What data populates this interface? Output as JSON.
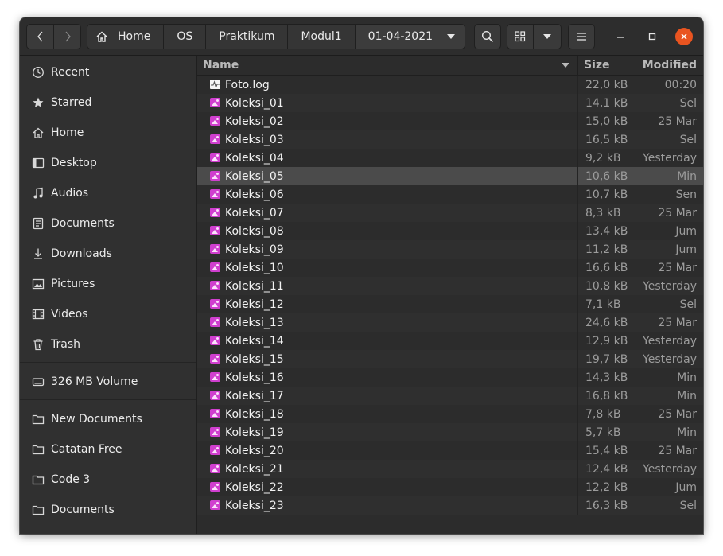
{
  "window": {
    "nav": {
      "back": "back",
      "forward": "forward"
    },
    "pathbar": [
      "Home",
      "OS",
      "Praktikum",
      "Modul1",
      "01-04-2021"
    ]
  },
  "sidebar": {
    "places": [
      {
        "label": "Recent",
        "icon": "clock-icon"
      },
      {
        "label": "Starred",
        "icon": "star-icon"
      },
      {
        "label": "Home",
        "icon": "home-icon"
      },
      {
        "label": "Desktop",
        "icon": "desktop-icon"
      },
      {
        "label": "Audios",
        "icon": "music-icon"
      },
      {
        "label": "Documents",
        "icon": "document-icon"
      },
      {
        "label": "Downloads",
        "icon": "download-icon"
      },
      {
        "label": "Pictures",
        "icon": "picture-icon"
      },
      {
        "label": "Videos",
        "icon": "film-icon"
      },
      {
        "label": "Trash",
        "icon": "trash-icon"
      }
    ],
    "devices": [
      {
        "label": "326 MB Volume",
        "icon": "drive-icon"
      }
    ],
    "bookmarks": [
      {
        "label": "New Documents",
        "icon": "folder-icon"
      },
      {
        "label": "Catatan Free",
        "icon": "folder-icon"
      },
      {
        "label": "Code 3",
        "icon": "folder-icon"
      },
      {
        "label": "Documents",
        "icon": "folder-icon"
      }
    ]
  },
  "columns": {
    "name": "Name",
    "size": "Size",
    "modified": "Modified"
  },
  "files": [
    {
      "name": "Foto.log",
      "size": "22,0 kB",
      "modified": "00:20",
      "type": "log"
    },
    {
      "name": "Koleksi_01",
      "size": "14,1 kB",
      "modified": "Sel",
      "type": "image"
    },
    {
      "name": "Koleksi_02",
      "size": "15,0 kB",
      "modified": "25 Mar",
      "type": "image"
    },
    {
      "name": "Koleksi_03",
      "size": "16,5 kB",
      "modified": "Sel",
      "type": "image"
    },
    {
      "name": "Koleksi_04",
      "size": "9,2 kB",
      "modified": "Yesterday",
      "type": "image"
    },
    {
      "name": "Koleksi_05",
      "size": "10,6 kB",
      "modified": "Min",
      "type": "image",
      "selected": true
    },
    {
      "name": "Koleksi_06",
      "size": "10,7 kB",
      "modified": "Sen",
      "type": "image"
    },
    {
      "name": "Koleksi_07",
      "size": "8,3 kB",
      "modified": "25 Mar",
      "type": "image"
    },
    {
      "name": "Koleksi_08",
      "size": "13,4 kB",
      "modified": "Jum",
      "type": "image"
    },
    {
      "name": "Koleksi_09",
      "size": "11,2 kB",
      "modified": "Jum",
      "type": "image"
    },
    {
      "name": "Koleksi_10",
      "size": "16,6 kB",
      "modified": "25 Mar",
      "type": "image"
    },
    {
      "name": "Koleksi_11",
      "size": "10,8 kB",
      "modified": "Yesterday",
      "type": "image"
    },
    {
      "name": "Koleksi_12",
      "size": "7,1 kB",
      "modified": "Sel",
      "type": "image"
    },
    {
      "name": "Koleksi_13",
      "size": "24,6 kB",
      "modified": "25 Mar",
      "type": "image"
    },
    {
      "name": "Koleksi_14",
      "size": "12,9 kB",
      "modified": "Yesterday",
      "type": "image"
    },
    {
      "name": "Koleksi_15",
      "size": "19,7 kB",
      "modified": "Yesterday",
      "type": "image"
    },
    {
      "name": "Koleksi_16",
      "size": "14,3 kB",
      "modified": "Min",
      "type": "image"
    },
    {
      "name": "Koleksi_17",
      "size": "16,8 kB",
      "modified": "Min",
      "type": "image"
    },
    {
      "name": "Koleksi_18",
      "size": "7,8 kB",
      "modified": "25 Mar",
      "type": "image"
    },
    {
      "name": "Koleksi_19",
      "size": "5,7 kB",
      "modified": "Min",
      "type": "image"
    },
    {
      "name": "Koleksi_20",
      "size": "15,4 kB",
      "modified": "25 Mar",
      "type": "image"
    },
    {
      "name": "Koleksi_21",
      "size": "12,4 kB",
      "modified": "Yesterday",
      "type": "image"
    },
    {
      "name": "Koleksi_22",
      "size": "12,2 kB",
      "modified": "Jum",
      "type": "image"
    },
    {
      "name": "Koleksi_23",
      "size": "16,3 kB",
      "modified": "Sel",
      "type": "image"
    }
  ],
  "colors": {
    "accent_close": "#e95420",
    "image_icon": "#d03fcf",
    "selection": "#4b4b4b"
  }
}
